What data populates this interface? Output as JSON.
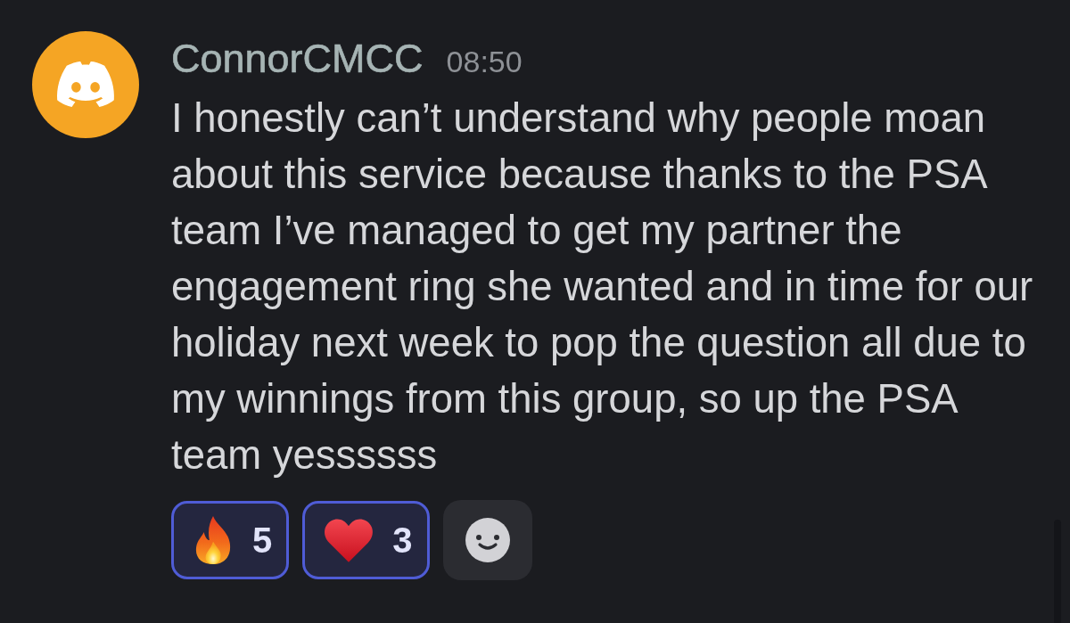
{
  "message": {
    "author": "ConnorCMCC",
    "timestamp": "08:50",
    "text": "I honestly can’t understand why people moan about this service because thanks to the PSA team I’ve managed to get my partner the engagement ring she wanted and in time for our holiday next week to pop the question all due to my winnings from this group, so up the PSA team yessssss"
  },
  "reactions": [
    {
      "kind": "fire",
      "count": "5",
      "selected": true
    },
    {
      "kind": "heart",
      "count": "3",
      "selected": true
    }
  ]
}
